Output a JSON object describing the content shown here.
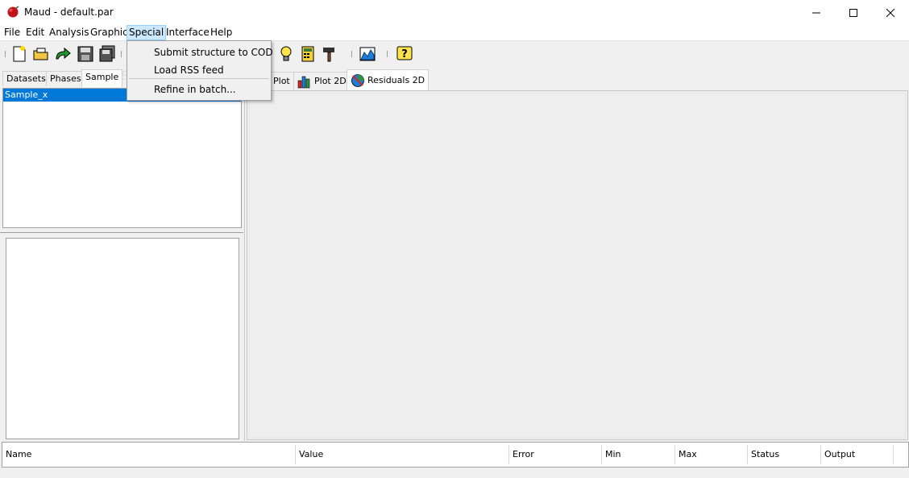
{
  "window": {
    "title": "Maud - default.par",
    "minimize_glyph": "—",
    "maximize_glyph": "☐",
    "close_glyph": "✕"
  },
  "menubar": {
    "items": [
      "File",
      "Edit",
      "Analysis",
      "Graphic",
      "Special",
      "Interface",
      "Help"
    ],
    "open_menu": "Special"
  },
  "special_menu": {
    "items": [
      "Submit structure to COD",
      "Load RSS feed",
      "Refine in batch..."
    ]
  },
  "toolbar": {
    "icons": [
      "new-file-icon",
      "open-folder-icon",
      "redo-arrow-icon",
      "save-disk-icon",
      "save-all-icon",
      "lightbulb-icon",
      "calculator-icon",
      "hammer-icon",
      "chart-icon",
      "help-icon"
    ]
  },
  "left_tabs": {
    "items": [
      "Datasets",
      "Phases",
      "Sample"
    ],
    "active": "Sample"
  },
  "sample_list": {
    "items": [
      "Sample_x"
    ],
    "selected": "Sample_x"
  },
  "right_tabs": {
    "items": [
      "Plot",
      "Plot 2D",
      "Residuals 2D"
    ],
    "active": "Residuals 2D"
  },
  "parameter_table": {
    "columns": [
      "Name",
      "Value",
      "Error",
      "Min",
      "Max",
      "Status",
      "Output"
    ]
  },
  "colors": {
    "selection": "#0078d7",
    "menu_highlight": "#cce8ff"
  }
}
